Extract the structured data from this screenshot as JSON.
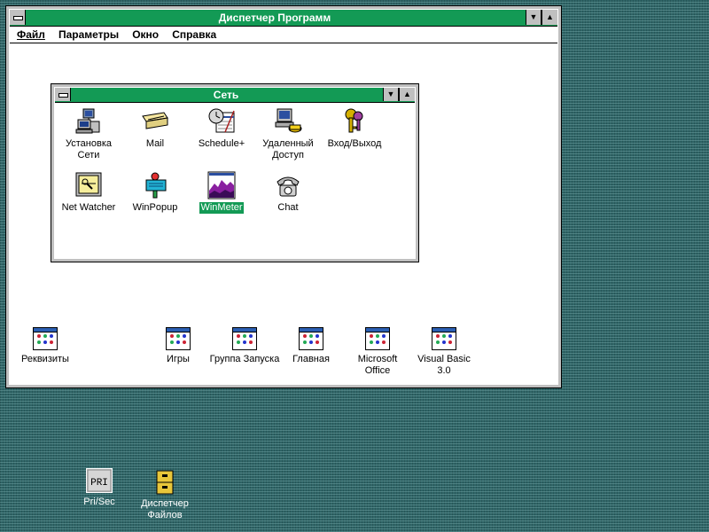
{
  "program_manager": {
    "title": "Диспетчер Программ",
    "menu": [
      "Файл",
      "Параметры",
      "Окно",
      "Справка"
    ],
    "groups": [
      {
        "label": "Реквизиты"
      },
      {
        "label": "Игры"
      },
      {
        "label": "Группа Запуска"
      },
      {
        "label": "Главная"
      },
      {
        "label": "Microsoft Office"
      },
      {
        "label": "Visual Basic 3.0"
      }
    ]
  },
  "network_group": {
    "title": "Сеть",
    "icons": [
      {
        "label": "Установка Сети",
        "icon": "network-setup-icon"
      },
      {
        "label": "Mail",
        "icon": "mail-icon"
      },
      {
        "label": "Schedule+",
        "icon": "schedule-icon"
      },
      {
        "label": "Удаленный Доступ",
        "icon": "remote-access-icon"
      },
      {
        "label": "Вход/Выход",
        "icon": "logon-keys-icon"
      },
      {
        "label": "Net Watcher",
        "icon": "net-watcher-icon"
      },
      {
        "label": "WinPopup",
        "icon": "winpopup-icon"
      },
      {
        "label": "WinMeter",
        "icon": "winmeter-icon",
        "selected": true
      },
      {
        "label": "Chat",
        "icon": "chat-phone-icon"
      }
    ]
  },
  "desktop": {
    "icons": [
      {
        "label": "Pri/Sec",
        "badge": "PRI",
        "icon": "pri-sec-icon"
      },
      {
        "label": "Диспетчер Файлов",
        "icon": "file-manager-icon"
      }
    ]
  },
  "colors": {
    "titlebar": "#139a55",
    "desktop": "#2f6466",
    "frame": "#c0c0c0"
  }
}
